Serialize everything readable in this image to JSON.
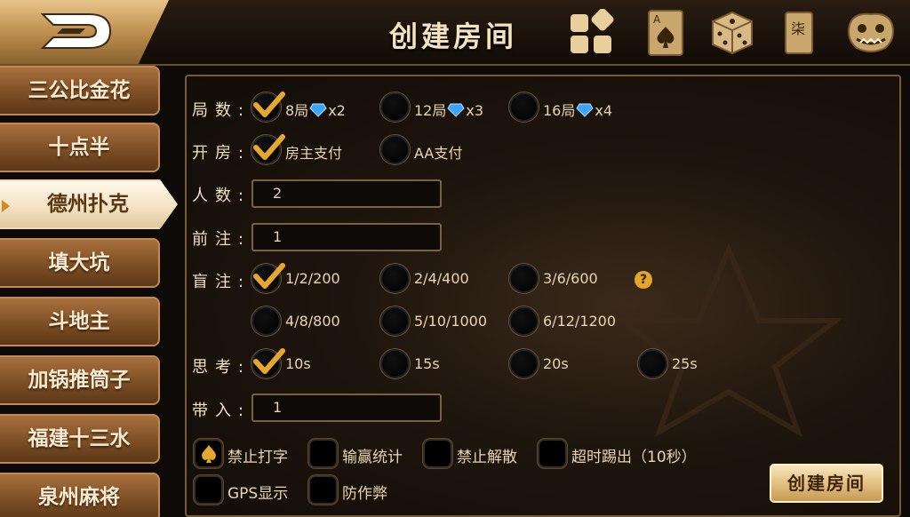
{
  "header": {
    "title": "创建房间",
    "icons": [
      "back-logo-icon",
      "grid-blocks-icon",
      "ace-of-spades-card-icon",
      "dice-icon",
      "mahjong-tile-icon",
      "lion-mask-icon"
    ],
    "mahjong_char": "柒",
    "card_rank": "A"
  },
  "sidebar": {
    "items": [
      {
        "label": "三公比金花",
        "active": false
      },
      {
        "label": "十点半",
        "active": false
      },
      {
        "label": "德州扑克",
        "active": true
      },
      {
        "label": "填大坑",
        "active": false
      },
      {
        "label": "斗地主",
        "active": false
      },
      {
        "label": "加锅推筒子",
        "active": false
      },
      {
        "label": "福建十三水",
        "active": false
      },
      {
        "label": "泉州麻将",
        "active": false
      }
    ]
  },
  "form": {
    "rounds": {
      "label": "局数:",
      "options": [
        {
          "text": "8局",
          "mult": "x2",
          "checked": true
        },
        {
          "text": "12局",
          "mult": "x3",
          "checked": false
        },
        {
          "text": "16局",
          "mult": "x4",
          "checked": false
        }
      ]
    },
    "room": {
      "label": "开房:",
      "options": [
        {
          "text": "房主支付",
          "checked": true
        },
        {
          "text": "AA支付",
          "checked": false
        }
      ]
    },
    "players": {
      "label": "人数:",
      "value": "2"
    },
    "ante": {
      "label": "前注:",
      "value": "1"
    },
    "blinds": {
      "label": "盲注:",
      "options": [
        {
          "text": "1/2/200",
          "checked": true
        },
        {
          "text": "2/4/400",
          "checked": false
        },
        {
          "text": "3/6/600",
          "checked": false
        },
        {
          "text": "4/8/800",
          "checked": false
        },
        {
          "text": "5/10/1000",
          "checked": false
        },
        {
          "text": "6/12/1200",
          "checked": false
        }
      ],
      "help": "?"
    },
    "think": {
      "label": "思考:",
      "options": [
        {
          "text": "10s",
          "checked": true
        },
        {
          "text": "15s",
          "checked": false
        },
        {
          "text": "20s",
          "checked": false
        },
        {
          "text": "25s",
          "checked": false
        }
      ]
    },
    "buyin": {
      "label": "带入:",
      "value": "1"
    },
    "extras": [
      {
        "text": "禁止打字",
        "checked": true
      },
      {
        "text": "输赢统计",
        "checked": false
      },
      {
        "text": "禁止解散",
        "checked": false
      },
      {
        "text": "超时踢出（10秒）",
        "checked": false
      },
      {
        "text": "GPS显示",
        "checked": false
      },
      {
        "text": "防作弊",
        "checked": false
      }
    ]
  },
  "create_button": "创建房间",
  "colors": {
    "accent": "#e2a72a",
    "gold": "#c79a55",
    "panel_border": "#7a5a34"
  }
}
